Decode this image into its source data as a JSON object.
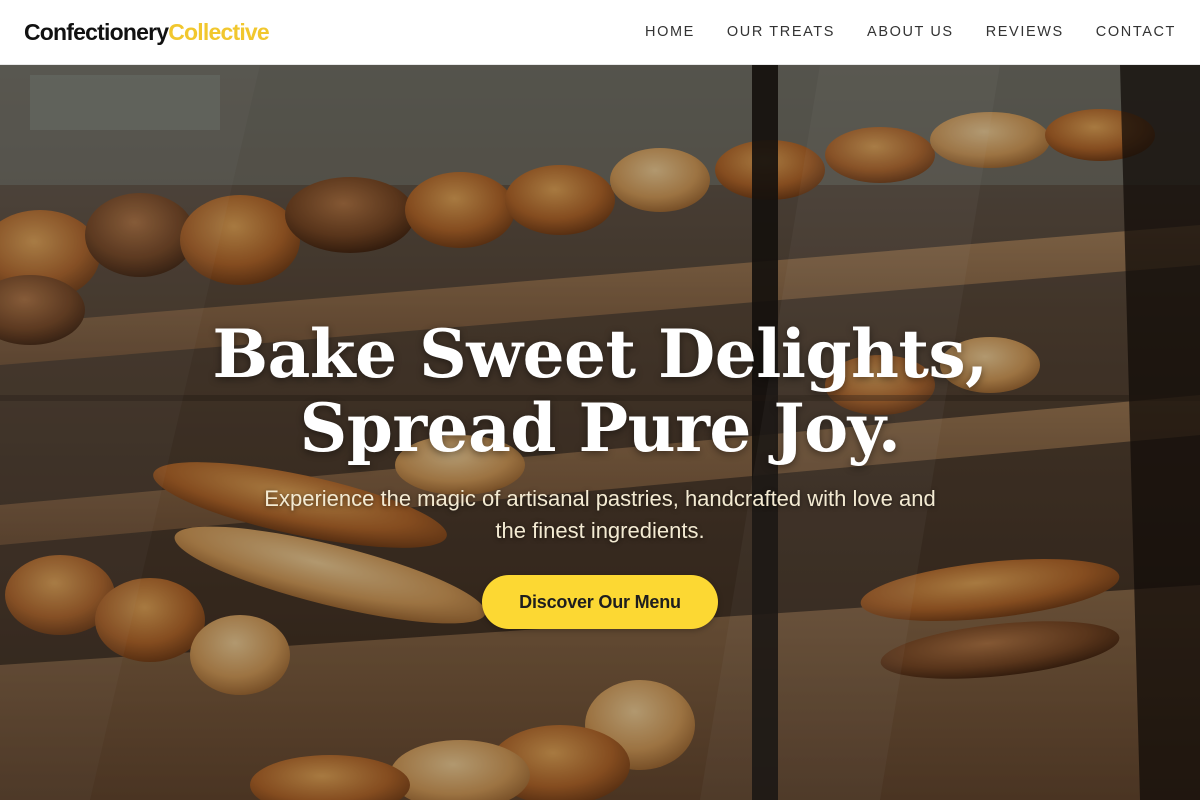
{
  "header": {
    "logo_primary": "Confectionery",
    "logo_accent": "Collective",
    "nav": [
      {
        "label": "HOME"
      },
      {
        "label": "OUR TREATS"
      },
      {
        "label": "ABOUT US"
      },
      {
        "label": "REVIEWS"
      },
      {
        "label": "CONTACT"
      }
    ]
  },
  "hero": {
    "title_line1": "Bake Sweet Delights,",
    "title_line2": "Spread Pure Joy.",
    "subtitle": "Experience the magic of artisanal pastries, handcrafted with love and the finest ingredients.",
    "cta_label": "Discover Our Menu",
    "background": "bakery-display-case-photo"
  },
  "colors": {
    "accent": "#f1c72e",
    "button": "#fcd833",
    "header_bg": "#ffffff",
    "nav_text": "#333333"
  }
}
